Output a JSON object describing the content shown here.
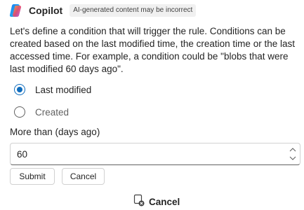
{
  "header": {
    "title": "Copilot",
    "badge": "AI-generated content may be incorrect"
  },
  "message": "Let's define a condition that will trigger the rule. Conditions can be created based on the last modified time, the creation time or the last accessed time. For example, a condition could be \"blobs that were last modified 60 days ago\".",
  "options": [
    {
      "label": "Last modified",
      "selected": true
    },
    {
      "label": "Created",
      "selected": false
    }
  ],
  "field": {
    "label": "More than (days ago)",
    "value": "60"
  },
  "buttons": {
    "submit": "Submit",
    "cancel": "Cancel"
  },
  "footer": {
    "cancel_label": "Cancel"
  },
  "colors": {
    "accent": "#0f6cbd",
    "text": "#242424",
    "badge_bg": "#f0f0f0"
  }
}
